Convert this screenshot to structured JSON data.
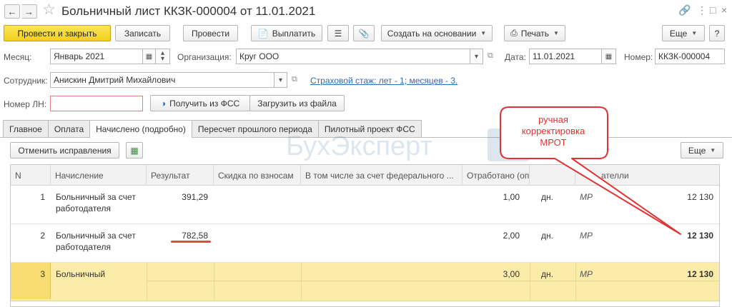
{
  "window": {
    "title": "Больничный лист ККЗК-000004 от 11.01.2021",
    "back_icon": "arrow-left-icon",
    "forward_icon": "arrow-right-icon"
  },
  "toolbar": {
    "post_close": "Провести и закрыть",
    "save": "Записать",
    "post": "Провести",
    "pay": "Выплатить",
    "create_based": "Создать на основании",
    "print": "Печать",
    "more": "Еще"
  },
  "form": {
    "month_label": "Месяц:",
    "month_value": "Январь 2021",
    "org_label": "Организация:",
    "org_value": "Круг ООО",
    "date_label": "Дата:",
    "date_value": "11.01.2021",
    "number_label": "Номер:",
    "number_value": "ККЗК-000004",
    "employee_label": "Сотрудник:",
    "employee_value": "Анискин Дмитрий Михайлович",
    "insurance_link": "Страховой стаж: лет - 1; месяцев - 3.",
    "ln_label": "Номер ЛН:",
    "ln_value": "",
    "get_fss": "Получить из ФСС",
    "load_file": "Загрузить из файла"
  },
  "tabs": [
    "Главное",
    "Оплата",
    "Начислено (подробно)",
    "Пересчет прошлого периода",
    "Пилотный проект ФСС"
  ],
  "grid_toolbar": {
    "cancel_fix": "Отменить исправления",
    "more": "Еще"
  },
  "watermark": {
    "text": "БухЭксперт",
    "box": "8"
  },
  "table": {
    "headers": [
      "N",
      "Начисление",
      "Результат",
      "Скидка по взносам",
      "В том числе за счет федерального ...",
      "Отработано (оплачено)",
      "",
      "ателли"
    ],
    "rows": [
      {
        "n": "1",
        "name1": "Больничный за счет",
        "name2": "работодателя",
        "result": "391,29",
        "days": "1,00",
        "unit": "дн.",
        "ind": "МР",
        "val": "12 130"
      },
      {
        "n": "2",
        "name1": "Больничный за счет",
        "name2": "работодателя",
        "result": "782,58",
        "days": "2,00",
        "unit": "дн.",
        "ind": "МР",
        "val": "12 130"
      },
      {
        "n": "3",
        "name1": "Больничный",
        "name2": "",
        "result": "",
        "days": "3,00",
        "unit": "дн.",
        "ind": "МР",
        "val": "12 130"
      }
    ]
  },
  "annotation": {
    "callout_line1": "ручная",
    "callout_line2": "корректировка",
    "callout_line3": "МРОТ",
    "color": "#e03333"
  }
}
